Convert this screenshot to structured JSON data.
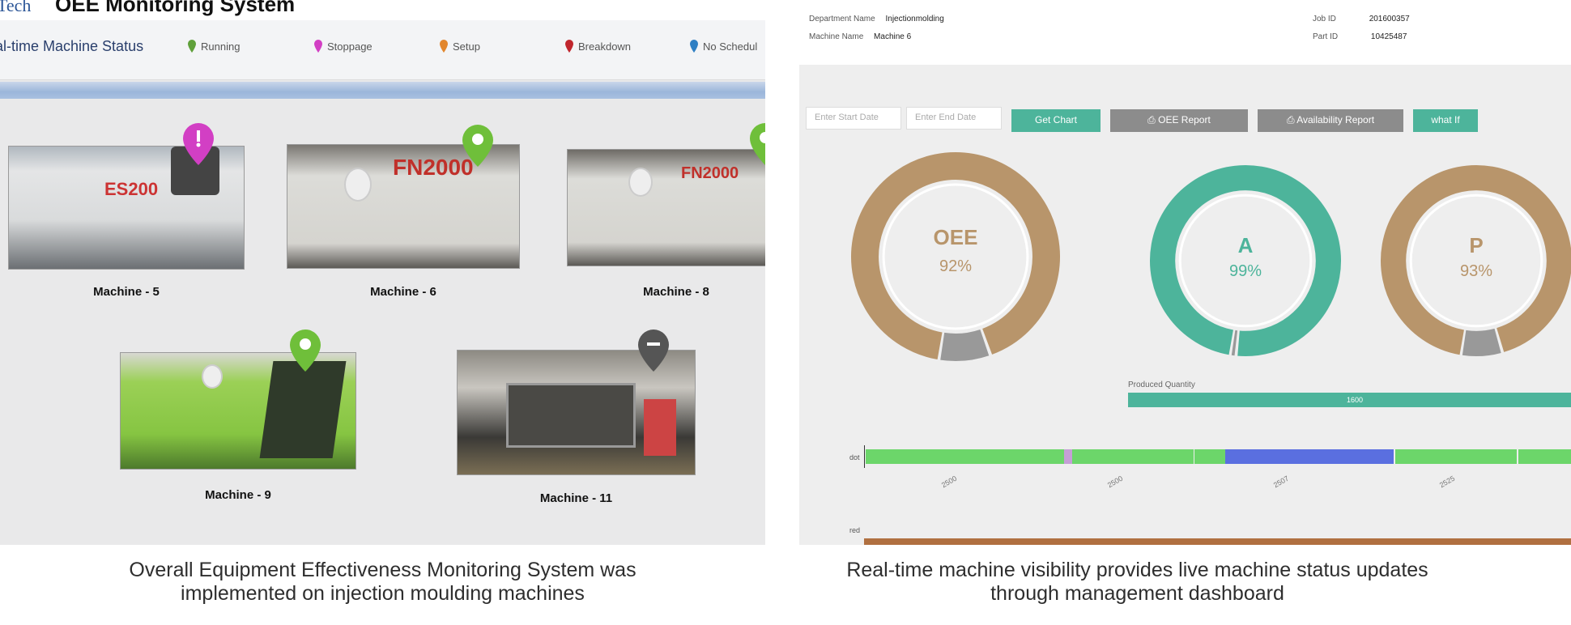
{
  "left_panel": {
    "logo_text": "Tech",
    "title": "OEE Monitoring System",
    "status_label": "al-time Machine Status",
    "legend": [
      {
        "label": "Running",
        "color": "#5fa03a"
      },
      {
        "label": "Stoppage",
        "color": "#d23fc4"
      },
      {
        "label": "Setup",
        "color": "#e2862d"
      },
      {
        "label": "Breakdown",
        "color": "#c0262d"
      },
      {
        "label": "No Schedul",
        "color": "#2f7fc3"
      }
    ],
    "machines": [
      {
        "label": "Machine - 5",
        "status": "stoppage",
        "pin_color": "#d23fc4",
        "body_color": "#d9dbdc",
        "brand": "ES200"
      },
      {
        "label": "Machine - 6",
        "status": "running",
        "pin_color": "#6fbf3a",
        "body_color": "#dcdcd8",
        "brand": "FN2000"
      },
      {
        "label": "Machine -  8",
        "status": "running",
        "pin_color": "#6fbf3a",
        "body_color": "#dcdcd8",
        "brand": "FN2000"
      },
      {
        "label": "Machine - 9",
        "status": "running",
        "pin_color": "#6fbf3a",
        "body_color": "#8ccc48",
        "brand": ""
      },
      {
        "label": "Machine - 11",
        "status": "no-schedule",
        "pin_color": "#555555",
        "body_color": "#c9c6c0",
        "brand": ""
      }
    ]
  },
  "right_panel": {
    "department_label": "Department Name",
    "department_value": "Injectionmolding",
    "machine_label": "Machine Name",
    "machine_value": "Machine 6",
    "job_label": "Job ID",
    "job_value": "201600357",
    "part_label": "Part ID",
    "part_value": "10425487",
    "start_placeholder": "Enter Start Date",
    "end_placeholder": "Enter End Date",
    "buttons": {
      "get_chart": "Get Chart",
      "oee_report": "OEE Report",
      "availability_report": "Availability Report",
      "what_if": "what If"
    },
    "donuts": [
      {
        "label": "OEE",
        "value": "92%",
        "percent": 92,
        "color": "#b8956b"
      },
      {
        "label": "A",
        "value": "99%",
        "percent": 99,
        "color": "#4db49b"
      },
      {
        "label": "P",
        "value": "93%",
        "percent": 93,
        "color": "#b8956b"
      }
    ],
    "produced_quantity_label": "Produced Quantity",
    "produced_quantity_value": "1600",
    "timeline_row_label": "dot",
    "timeline_bottom_label": "red",
    "timeline_ticks": [
      "2500",
      "2500",
      "2507",
      "2525"
    ]
  },
  "captions": {
    "left_line1": "Overall Equipment Effectiveness Monitoring System was",
    "left_line2": "implemented on injection moulding machines",
    "right_line1": "Real-time machine visibility provides live machine status updates",
    "right_line2": "through management dashboard"
  }
}
